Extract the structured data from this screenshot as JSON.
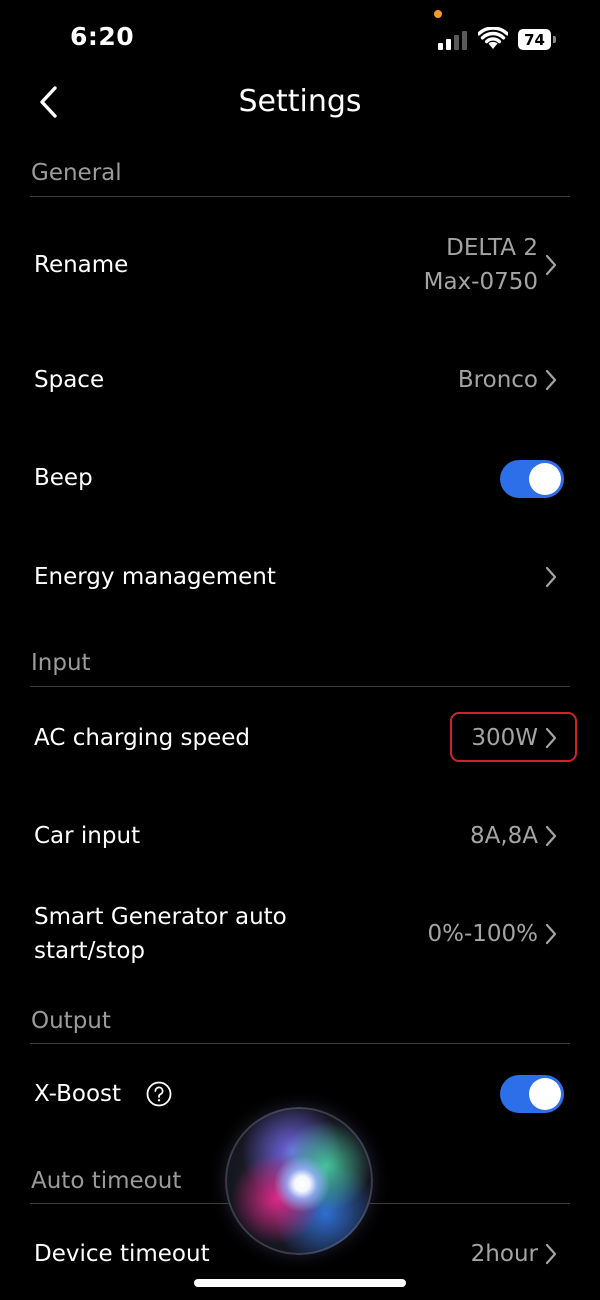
{
  "status_bar": {
    "time": "6:20",
    "battery_level": "74",
    "signal_bars_active": 2,
    "signal_bars_total": 4,
    "mic_indicator_color": "#f39a2b"
  },
  "header": {
    "back_icon": "chevron-left-icon",
    "title": "Settings"
  },
  "sections": {
    "general": {
      "title": "General",
      "rename": {
        "label": "Rename",
        "value_line1": "DELTA 2",
        "value_line2": "Max-0750"
      },
      "space": {
        "label": "Space",
        "value": "Bronco"
      },
      "beep": {
        "label": "Beep",
        "enabled": true
      },
      "energy_management": {
        "label": "Energy management"
      }
    },
    "input": {
      "title": "Input",
      "ac_charging_speed": {
        "label": "AC charging speed",
        "value": "300W",
        "highlighted": true
      },
      "car_input": {
        "label": "Car input",
        "value": "8A,8A"
      },
      "smart_generator": {
        "label_line1": "Smart Generator auto",
        "label_line2": "start/stop",
        "value": "0%-100%"
      }
    },
    "output": {
      "title": "Output",
      "x_boost": {
        "label": "X-Boost",
        "enabled": true,
        "help_icon": "question-circle-icon"
      }
    },
    "auto_timeout": {
      "title": "Auto timeout",
      "device_timeout": {
        "label": "Device timeout",
        "value": "2hour"
      }
    }
  },
  "colors": {
    "background": "#000000",
    "toggle_on": "#2c6fe8",
    "highlight_border": "#d3212c",
    "section_title": "#9b9b9b",
    "value_text": "#a4a4a4"
  }
}
